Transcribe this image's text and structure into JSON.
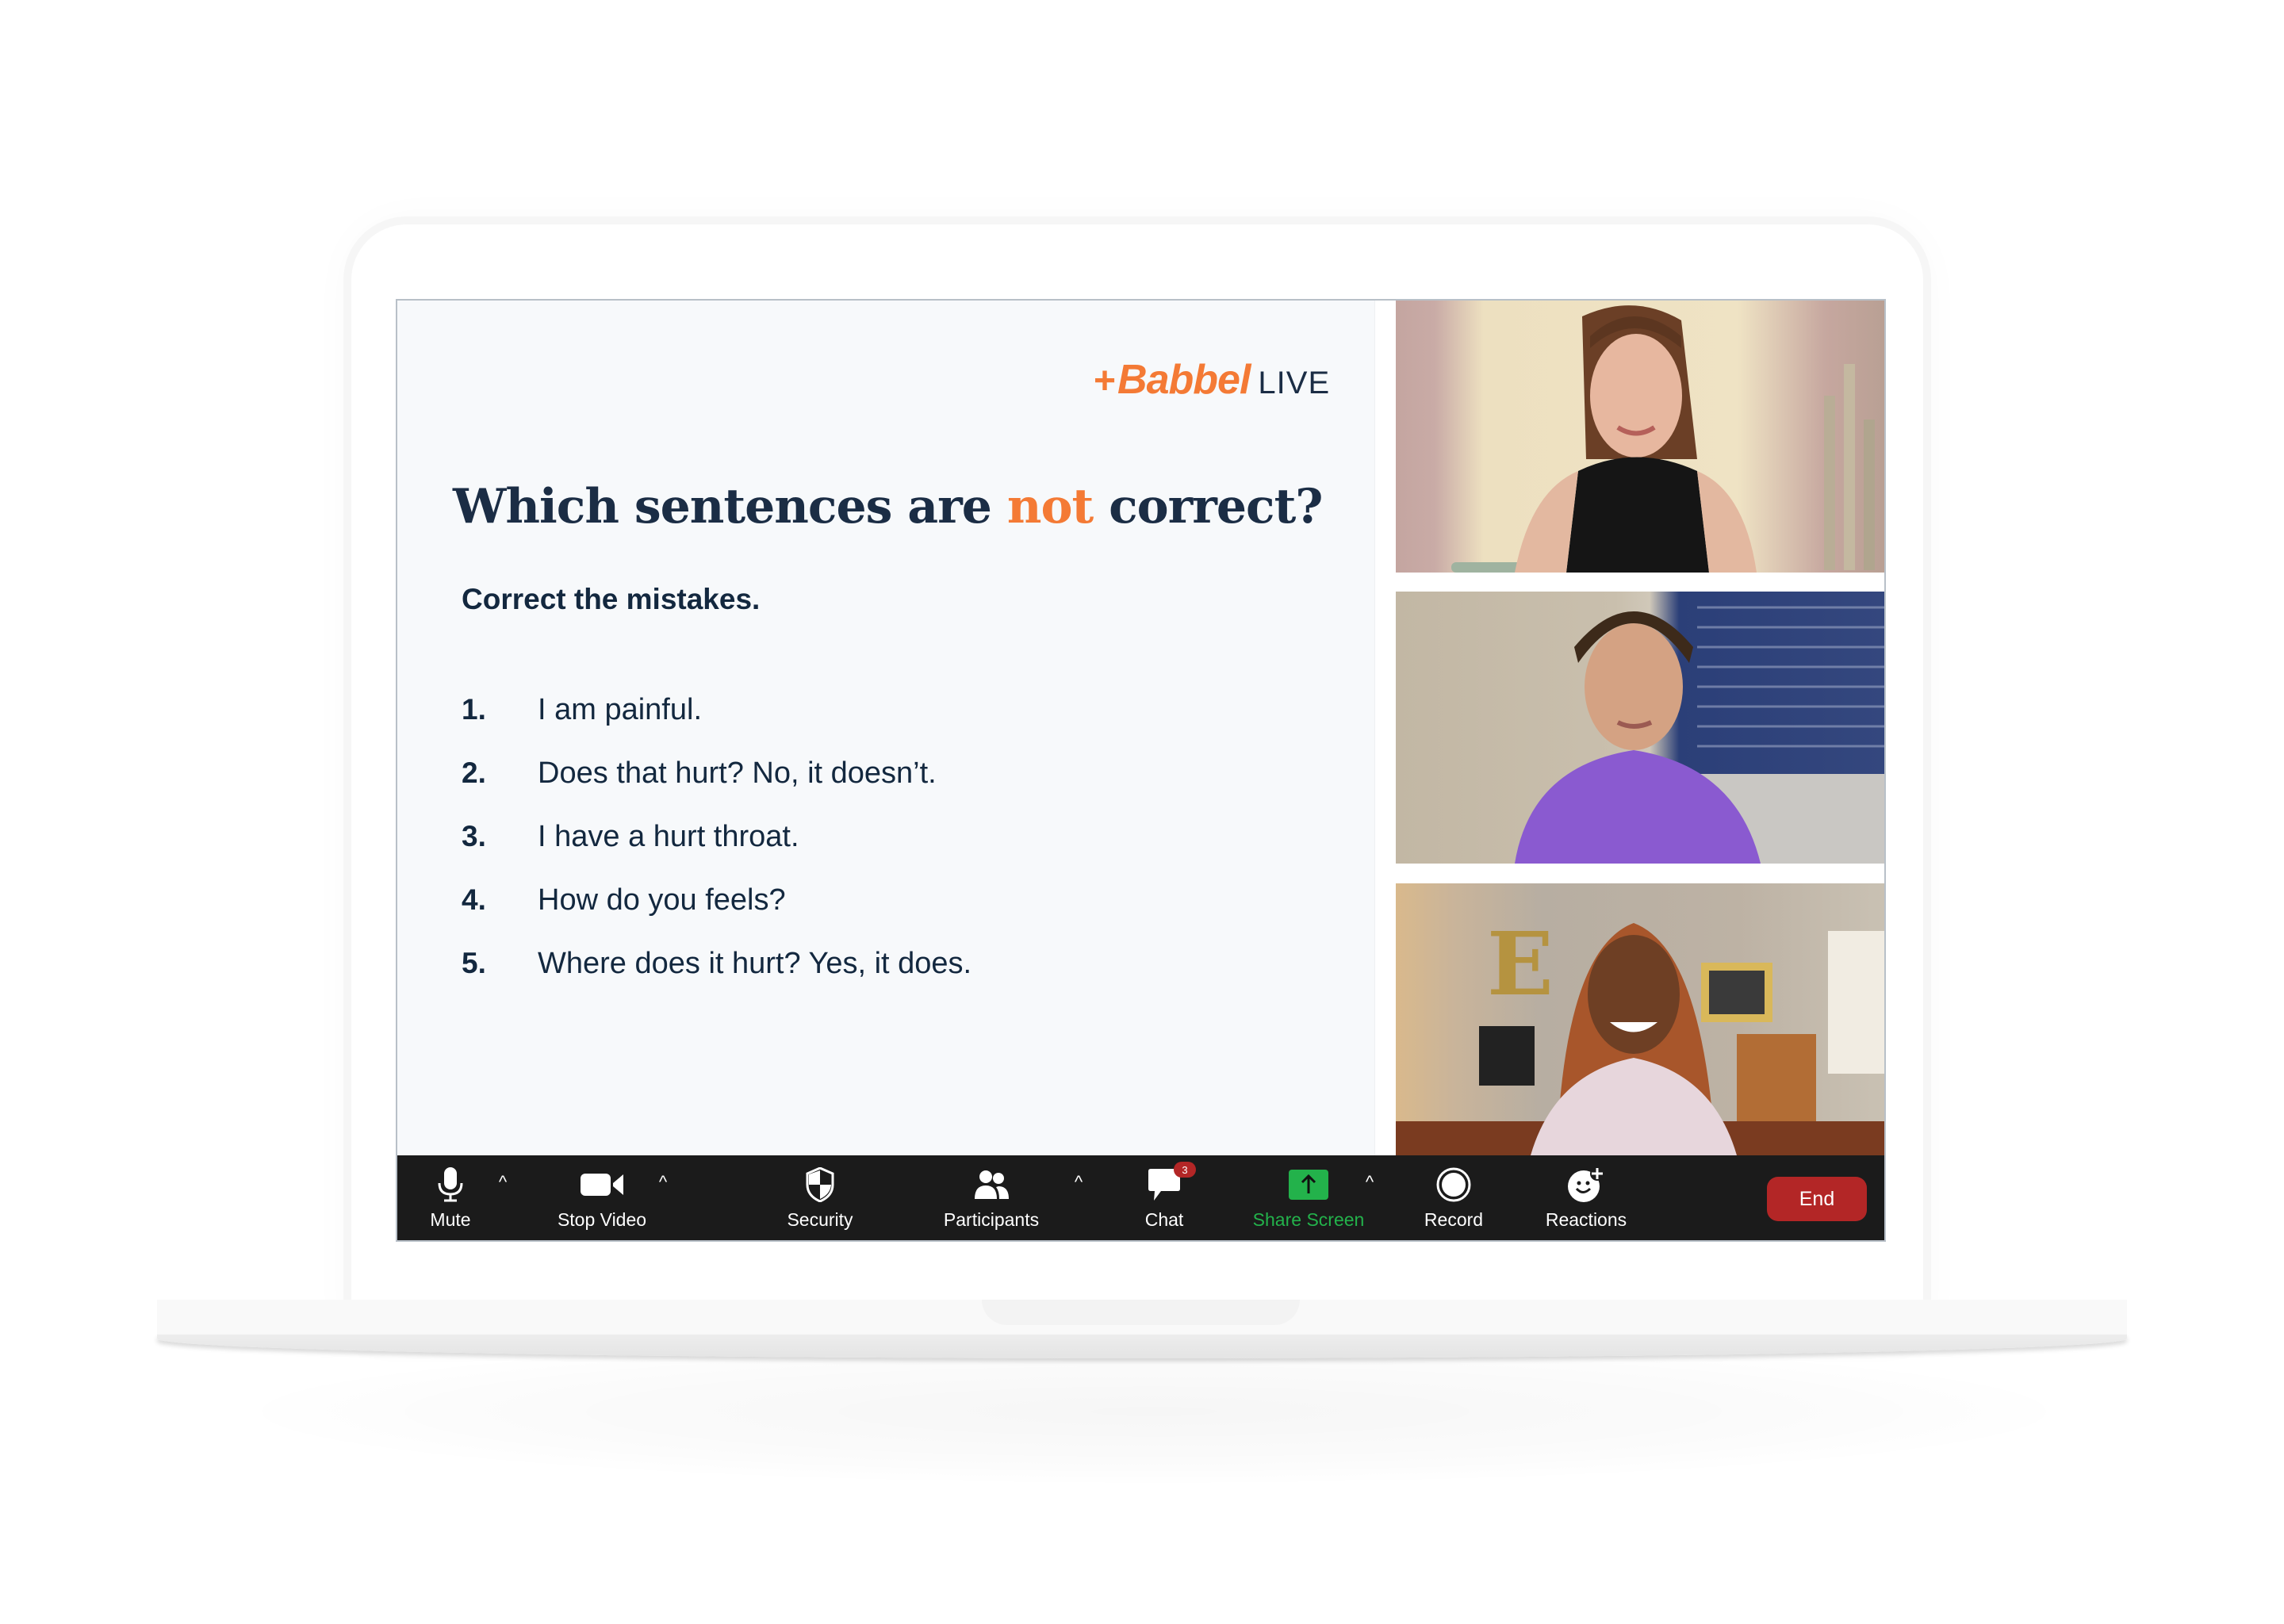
{
  "slide": {
    "logo": {
      "brand": "Babbel",
      "suffix": "LIVE",
      "plus": "+"
    },
    "title": {
      "before": "Which sentences are ",
      "accent": "not",
      "after": " correct?"
    },
    "subtitle": "Correct the mistakes.",
    "items": [
      {
        "num": "1.",
        "text": "I am painful."
      },
      {
        "num": "2.",
        "text": "Does that hurt? No, it doesn’t."
      },
      {
        "num": "3.",
        "text": "I have a hurt throat."
      },
      {
        "num": "4.",
        "text": "How do you feels?"
      },
      {
        "num": "5.",
        "text": "Where does it hurt? Yes, it does."
      }
    ]
  },
  "participants": [
    {
      "name": "participant-1",
      "description": "woman with brown hair, black top, botanical print background"
    },
    {
      "name": "participant-2",
      "description": "woman with bob haircut, purple t-shirt, window blinds background"
    },
    {
      "name": "participant-3",
      "description": "woman with auburn hair, light pink shirt, framed pictures and letter E background"
    }
  ],
  "toolbar": {
    "mute": {
      "label": "Mute",
      "icon": "microphone-icon"
    },
    "stop_video": {
      "label": "Stop Video",
      "icon": "video-camera-icon"
    },
    "security": {
      "label": "Security",
      "icon": "shield-icon"
    },
    "participants": {
      "label": "Participants",
      "icon": "participants-icon"
    },
    "chat": {
      "label": "Chat",
      "icon": "chat-bubble-icon",
      "badge": "3"
    },
    "share_screen": {
      "label": "Share Screen",
      "icon": "share-screen-icon"
    },
    "record": {
      "label": "Record",
      "icon": "record-icon"
    },
    "reactions": {
      "label": "Reactions",
      "icon": "reaction-smiley-icon"
    },
    "end": {
      "label": "End"
    },
    "caret": "^"
  },
  "colors": {
    "brand_orange": "#f47a35",
    "navy_text": "#1b2d45",
    "toolbar_bg": "#1b1b1b",
    "share_green": "#23b24b",
    "end_red": "#b32626"
  }
}
